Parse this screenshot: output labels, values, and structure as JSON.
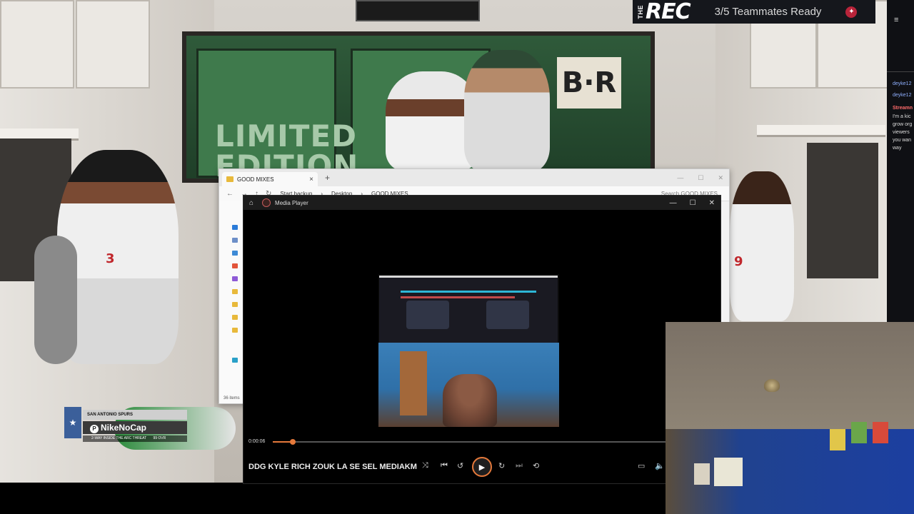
{
  "rec_banner": {
    "the": "THE",
    "rec": "REC",
    "teammates_status": "3/5 Teammates Ready"
  },
  "nameplate": {
    "team_label": "SAN ANTONIO SPURS",
    "gamertag": "NikeNoCap",
    "subline": "2-WAY INSIDE THE ARC THREAT",
    "ovr": "99 OVR"
  },
  "jersey_numbers": [
    "3",
    "9"
  ],
  "explorer": {
    "tab_title": "GOOD MIXES",
    "breadcrumb": [
      "Start backup",
      "Desktop",
      "GOOD MIXES"
    ],
    "search_placeholder": "Search GOOD MIXES",
    "item_count": "36 items"
  },
  "media_player": {
    "title": "Media Player",
    "current_time": "0:00:06",
    "progress": 0.05,
    "song_title": "DDG KYLE RICH ZOUK LA SE SEL MEDIAKM...",
    "accent_color": "#e5793b"
  },
  "chat": {
    "messages": [
      "deyke12",
      "deyke12",
      "Streamn",
      "I'm a kic",
      "grow org",
      "viewers",
      "you wan",
      "way"
    ]
  },
  "icons": {
    "home": "home-icon",
    "shuffle": "shuffle-icon",
    "previous": "previous-icon",
    "rewind": "rewind-10-icon",
    "play": "play-icon",
    "forward": "forward-30-icon",
    "next": "next-icon",
    "repeat": "repeat-icon",
    "miniplayer": "miniplayer-icon",
    "volume": "volume-icon"
  }
}
